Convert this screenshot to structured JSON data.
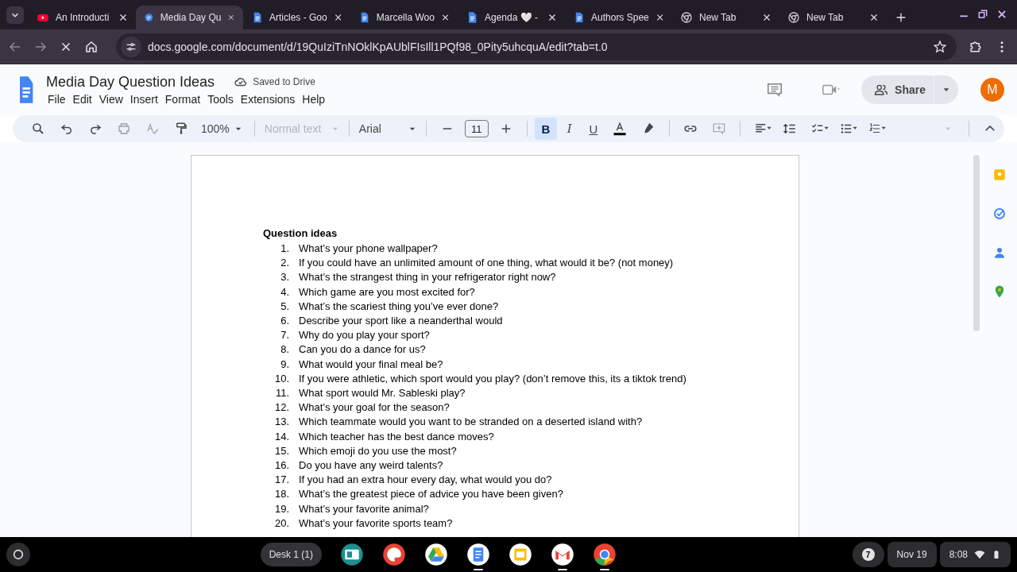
{
  "tab_strip": {
    "tabs": [
      {
        "title": "An Introducti",
        "kind": "video",
        "selected": false
      },
      {
        "title": "Media Day Qu",
        "kind": "loading",
        "selected": true
      },
      {
        "title": "Articles - Goo",
        "kind": "document",
        "selected": false
      },
      {
        "title": "Marcella Woo",
        "kind": "document",
        "selected": false
      },
      {
        "title": "Agenda 🤍 -",
        "kind": "document",
        "selected": false
      },
      {
        "title": "Authors Spee",
        "kind": "document",
        "selected": false
      },
      {
        "title": "New Tab",
        "kind": "newtab",
        "selected": false
      },
      {
        "title": "New Tab",
        "kind": "newtab",
        "selected": false
      }
    ]
  },
  "address_bar": {
    "url": "docs.google.com/document/d/19QuIziTnNOklKpAUblFIsIll1PQf98_0Pity5uhcquA/edit?tab=t.0"
  },
  "document": {
    "title": "Media Day Question Ideas",
    "save_status": "Saved to Drive",
    "menu": [
      "File",
      "Edit",
      "View",
      "Insert",
      "Format",
      "Tools",
      "Extensions",
      "Help"
    ],
    "share_label": "Share",
    "avatar_letter": "M"
  },
  "toolbar": {
    "zoom": "100%",
    "style": "Normal text",
    "font": "Arial",
    "font_size": "11",
    "formatting": [
      {
        "kind": "bold",
        "label": "B",
        "selected": true
      },
      {
        "kind": "italic",
        "label": "I",
        "selected": false
      },
      {
        "kind": "underline",
        "label": "U",
        "selected": false
      }
    ]
  },
  "page": {
    "heading": "Question ideas",
    "items": [
      {
        "number": "1.",
        "text": "What’s your phone wallpaper?"
      },
      {
        "number": "2.",
        "text": "If you could have an unlimited amount of one thing, what would it be? (not money)"
      },
      {
        "number": "3.",
        "text": "What’s the strangest thing in your refrigerator right now?"
      },
      {
        "number": "4.",
        "text": "Which game are you most excited for?"
      },
      {
        "number": "5.",
        "text": "What’s the scariest thing you’ve ever done?"
      },
      {
        "number": "6.",
        "text": "Describe your sport like a neanderthal would"
      },
      {
        "number": "7.",
        "text": "Why do you play your sport?"
      },
      {
        "number": "8.",
        "text": "Can you do a dance for us?"
      },
      {
        "number": "9.",
        "text": "What would your final meal be?"
      },
      {
        "number": "10.",
        "text": "If you were athletic, which sport would you play? (don’t remove this, its a tiktok trend)"
      },
      {
        "number": "11.",
        "text": "What sport would Mr. Sableski play?"
      },
      {
        "number": "12.",
        "text": "What’s your goal for the season?"
      },
      {
        "number": "13.",
        "text": "Which teammate would you want to be stranded on a deserted island with?"
      },
      {
        "number": "14.",
        "text": "Which teacher has the best dance moves?"
      },
      {
        "number": "15.",
        "text": "Which emoji do you use the most?"
      },
      {
        "number": "16.",
        "text": "Do you have any weird talents?"
      },
      {
        "number": "17.",
        "text": "If you had an extra hour every day, what would you do?"
      },
      {
        "number": "18.",
        "text": "What’s the greatest piece of advice you have been given?"
      },
      {
        "number": "19.",
        "text": "What’s your favorite animal?"
      },
      {
        "number": "20.",
        "text": "What’s your favorite sports team?"
      }
    ]
  },
  "shelf": {
    "desk": "Desk 1 (1)",
    "apps": [
      {
        "kind": "classroom",
        "open": false
      },
      {
        "kind": "paint",
        "open": false
      },
      {
        "kind": "drive",
        "open": false
      },
      {
        "kind": "docs",
        "open": true
      },
      {
        "kind": "slides",
        "open": false
      },
      {
        "kind": "gmail",
        "open": true
      },
      {
        "kind": "chrome",
        "open": true
      }
    ],
    "notification_count": "7",
    "date": "Nov 19",
    "time": "8:08"
  }
}
